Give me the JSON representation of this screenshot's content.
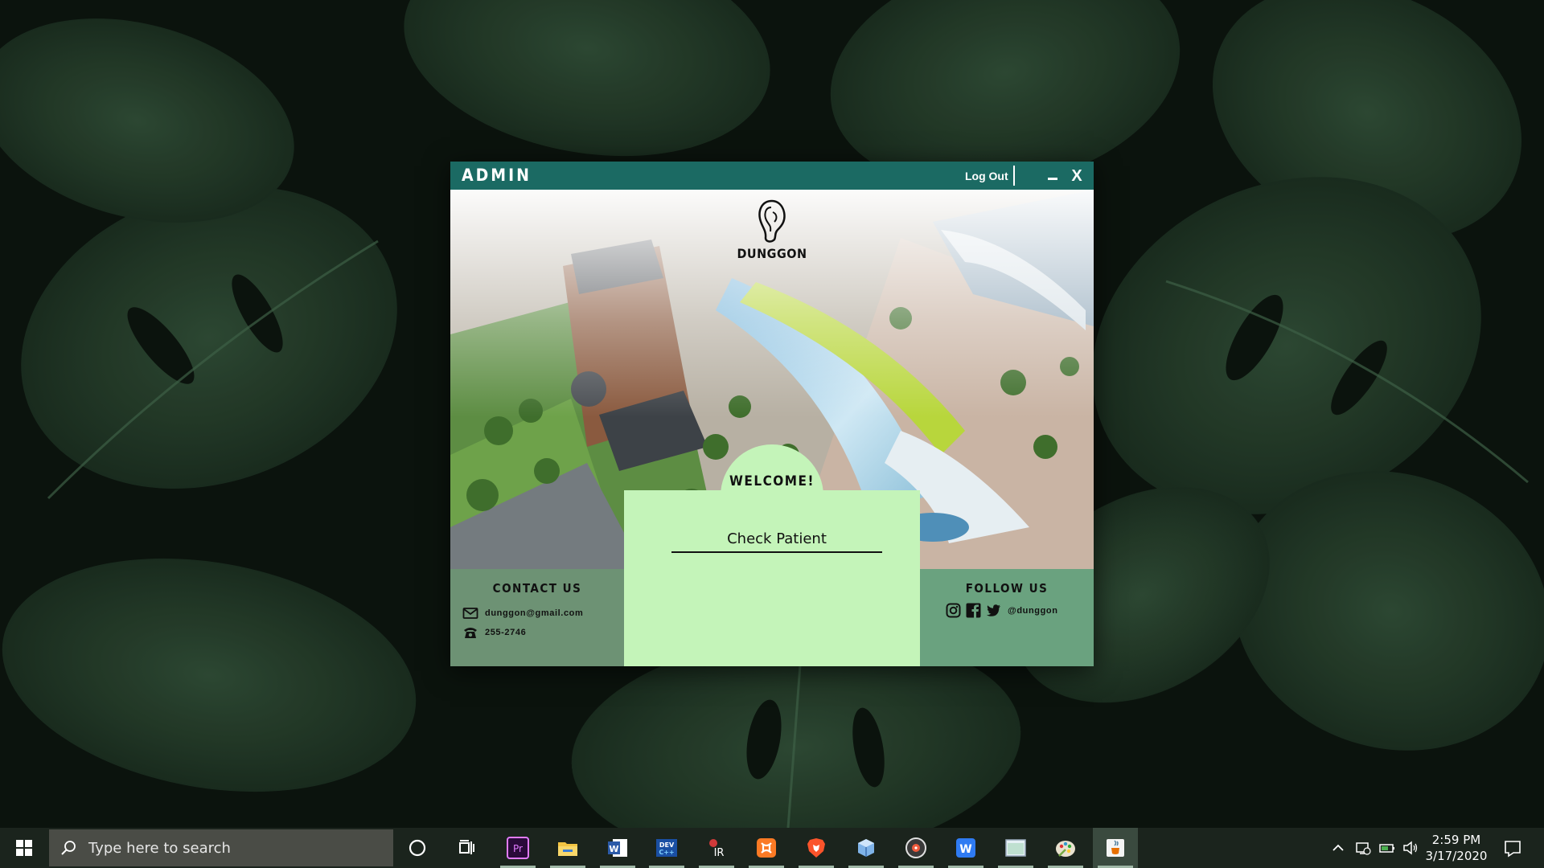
{
  "window": {
    "title": "ADMIN",
    "logout_label": "Log Out",
    "minimize_label": "",
    "close_label": "X"
  },
  "brand": {
    "name": "DUNGGON"
  },
  "welcome": {
    "title": "WELCOME!",
    "check_patient_label": "Check Patient"
  },
  "contact": {
    "heading": "CONTACT US",
    "email": "dunggon@gmail.com",
    "phone": "255-2746"
  },
  "follow": {
    "heading": "FOLLOW US",
    "handle": "@dunggon"
  },
  "taskbar": {
    "search_placeholder": "Type here to search",
    "time": "2:59 PM",
    "date": "3/17/2020",
    "pinned": [
      "cortana-icon",
      "task-view-icon",
      "premiere-pro-icon",
      "file-explorer-icon",
      "word-icon",
      "dev-c-icon",
      "app-ir-icon",
      "xampp-icon",
      "brave-icon",
      "virtualbox-icon",
      "music-disc-icon",
      "wps-writer-icon",
      "preview-window-icon",
      "paint-icon",
      "java-icon"
    ]
  },
  "colors": {
    "titlebar": "#1b6a63",
    "card": "#c4f4b9",
    "contact_panel": "#6d9274",
    "follow_panel": "#6aa27f",
    "taskbar": "#1b241d"
  }
}
